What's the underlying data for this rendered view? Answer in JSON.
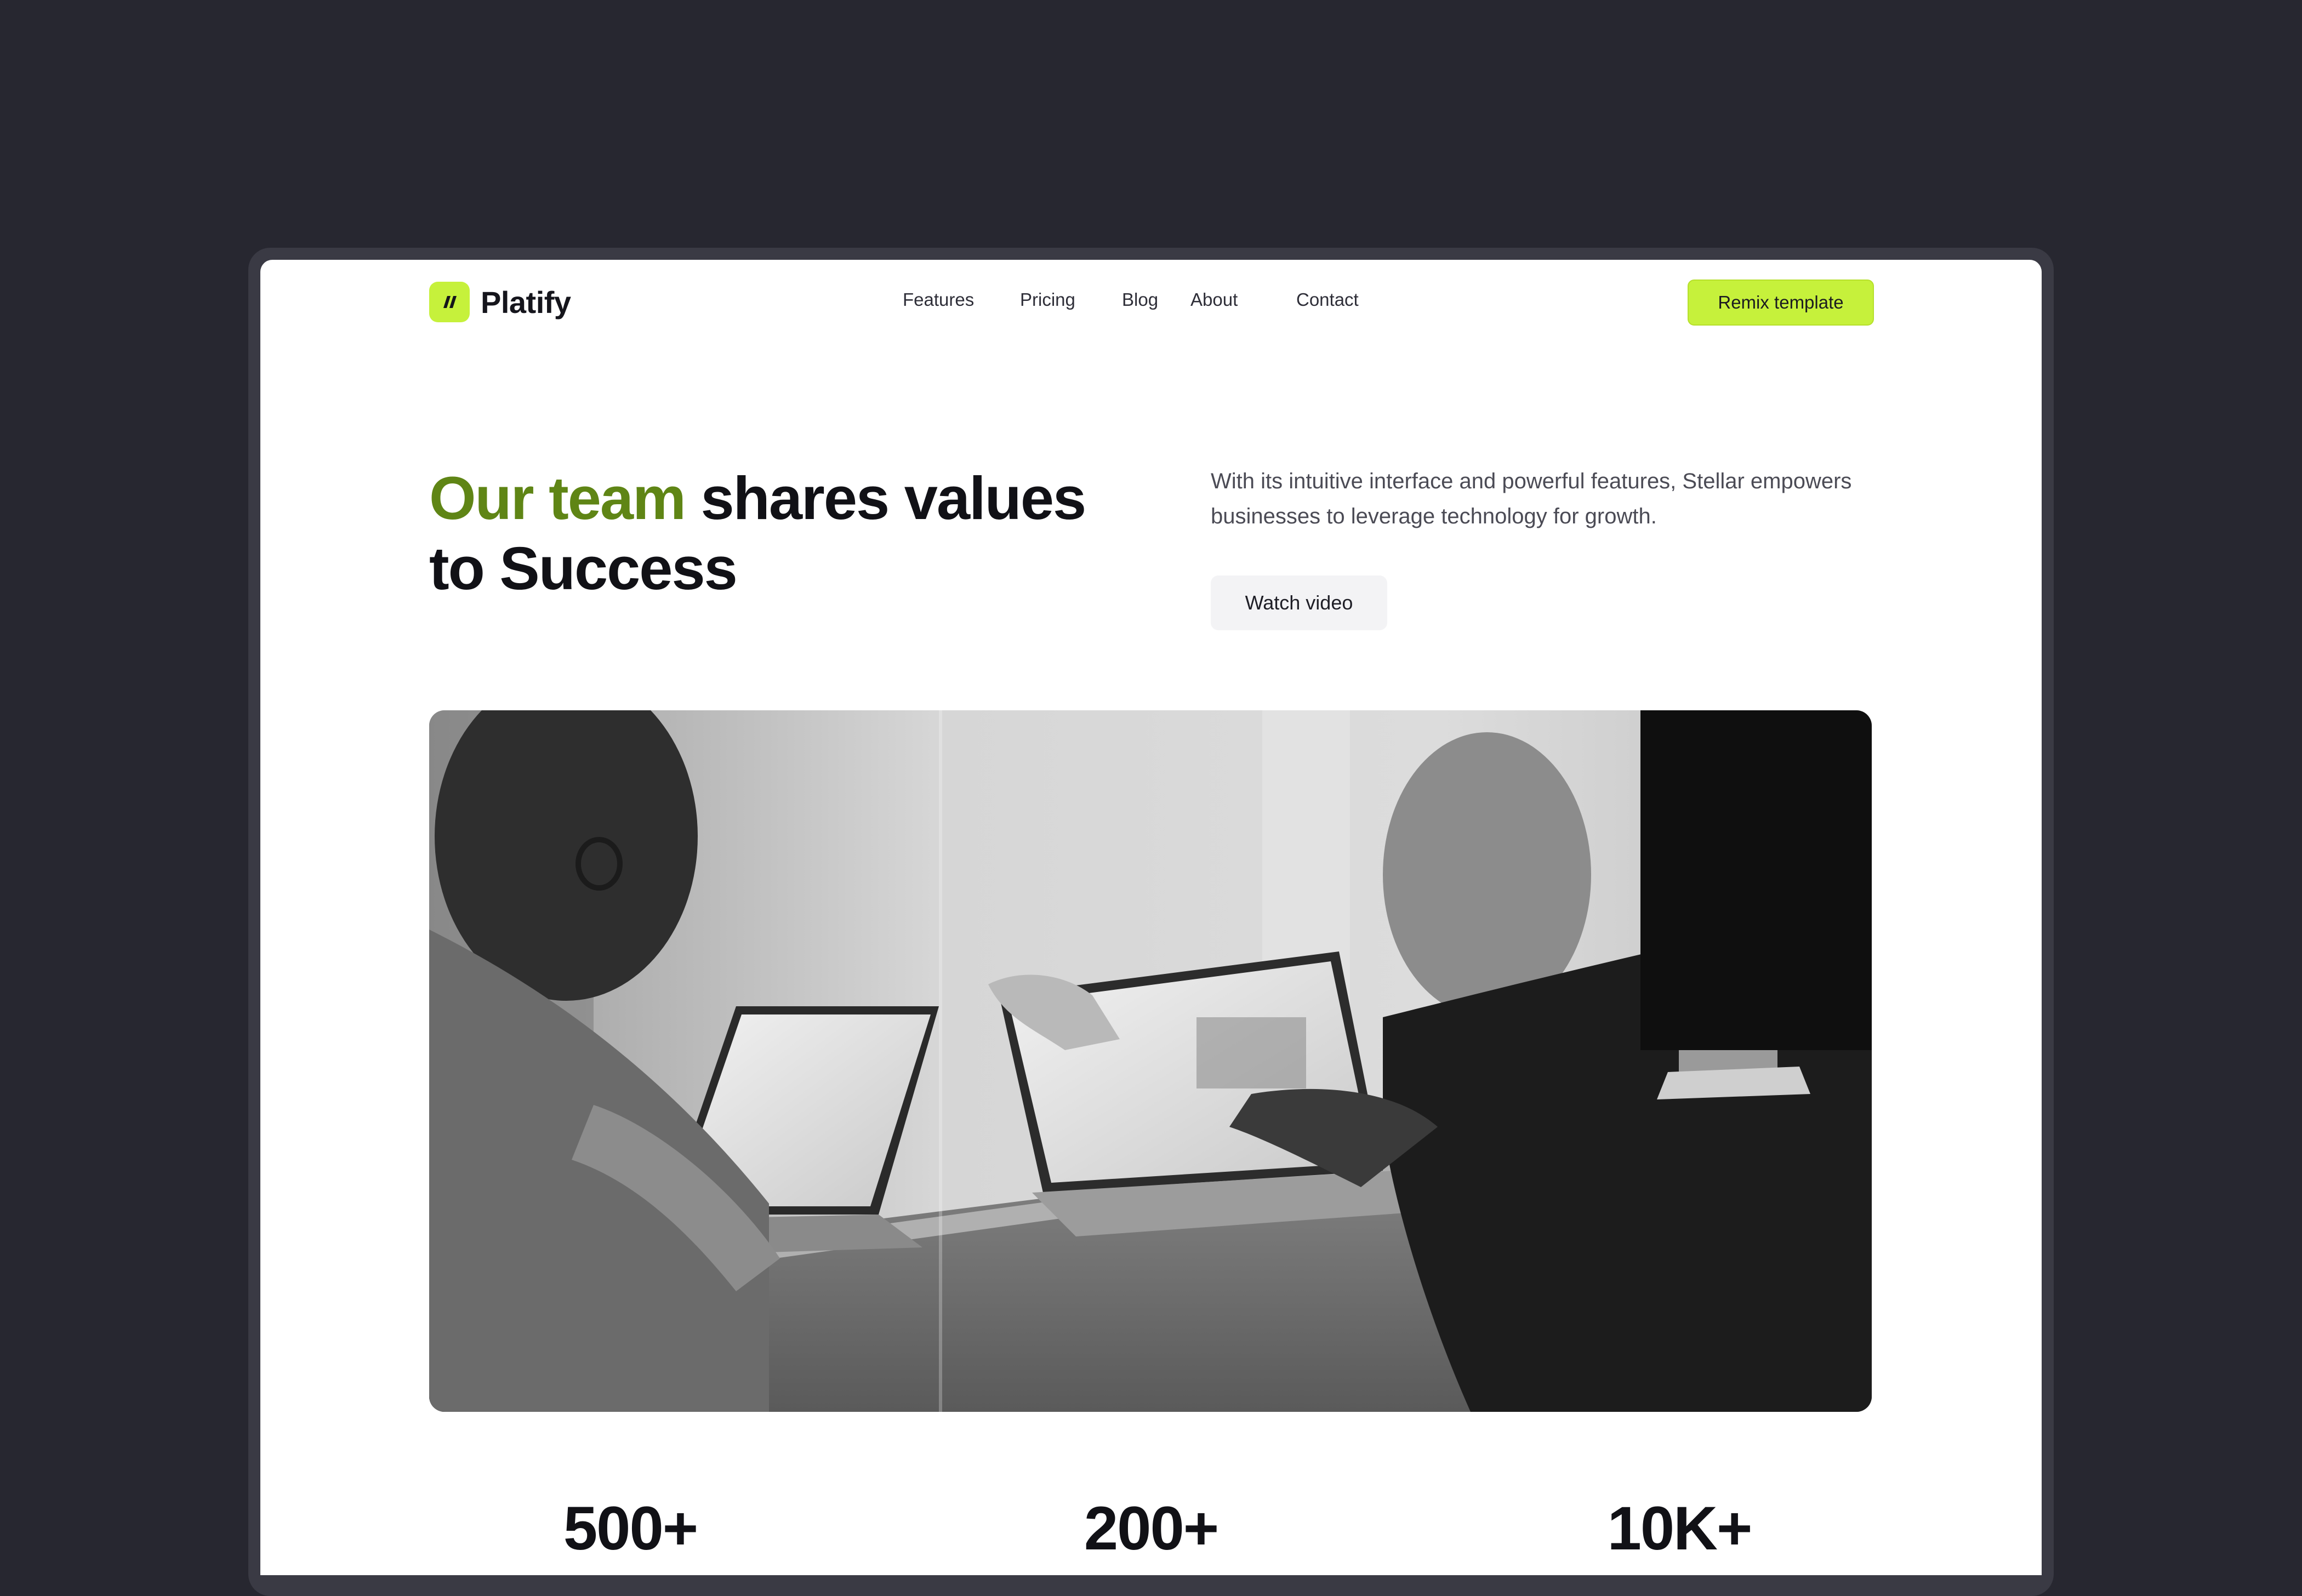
{
  "brand": {
    "name": "Platify",
    "accent": "#c6f13b",
    "headline_accent": "#5f8515"
  },
  "nav": {
    "links": [
      {
        "label": "Features"
      },
      {
        "label": "Pricing"
      },
      {
        "label": "Blog"
      },
      {
        "label": "About"
      },
      {
        "label": "Contact"
      }
    ],
    "cta_label": "Remix template"
  },
  "hero": {
    "headline_accent": "Our team",
    "headline_rest": " shares values to Success",
    "description": "With its intuitive interface and powerful features, Stellar empowers businesses to leverage technology for growth.",
    "video_button_label": "Watch video"
  },
  "image": {
    "icon": "team-photo",
    "alt": ""
  },
  "stats": [
    {
      "value": "500+"
    },
    {
      "value": "200+"
    },
    {
      "value": "10K+"
    }
  ]
}
